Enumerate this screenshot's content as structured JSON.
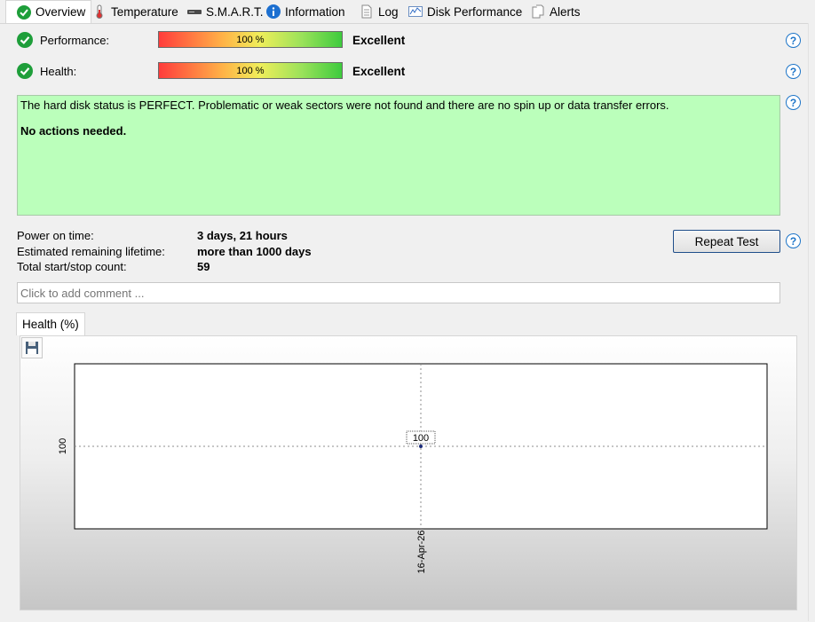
{
  "tabs": [
    {
      "label": "Overview",
      "icon": "green-check-icon",
      "active": true
    },
    {
      "label": "Temperature",
      "icon": "thermometer-icon"
    },
    {
      "label": "S.M.A.R.T.",
      "icon": "disk-drive-icon"
    },
    {
      "label": "Information",
      "icon": "info-icon"
    },
    {
      "label": "Log",
      "icon": "document-icon"
    },
    {
      "label": "Disk Performance",
      "icon": "performance-chart-icon"
    },
    {
      "label": "Alerts",
      "icon": "alerts-document-icon"
    }
  ],
  "performance": {
    "label": "Performance:",
    "value_text": "100 %",
    "value": 100,
    "rating": "Excellent"
  },
  "health": {
    "label": "Health:",
    "value_text": "100 %",
    "value": 100,
    "rating": "Excellent"
  },
  "status": {
    "message": "The hard disk status is PERFECT. Problematic or weak sectors were not found and there are no spin up or data transfer errors.",
    "action": "No actions needed.",
    "color": "#bbffbb"
  },
  "info": {
    "power_on_label": "Power on time:",
    "power_on_value": "3 days, 21 hours",
    "lifetime_label": "Estimated remaining lifetime:",
    "lifetime_value": "more than 1000 days",
    "startstop_label": "Total start/stop count:",
    "startstop_value": "59"
  },
  "repeat_test_label": "Repeat Test",
  "help_glyph": "?",
  "comment_placeholder": "Click to add comment ...",
  "chart_tab_label": "Health (%)",
  "chart_data": {
    "type": "line",
    "title": "",
    "x": [
      "16-Apr-26"
    ],
    "series": [
      {
        "values": [
          100
        ]
      }
    ],
    "point_label": "100",
    "ytick": "100",
    "xlabel": "",
    "ylabel": "",
    "grid": true
  }
}
